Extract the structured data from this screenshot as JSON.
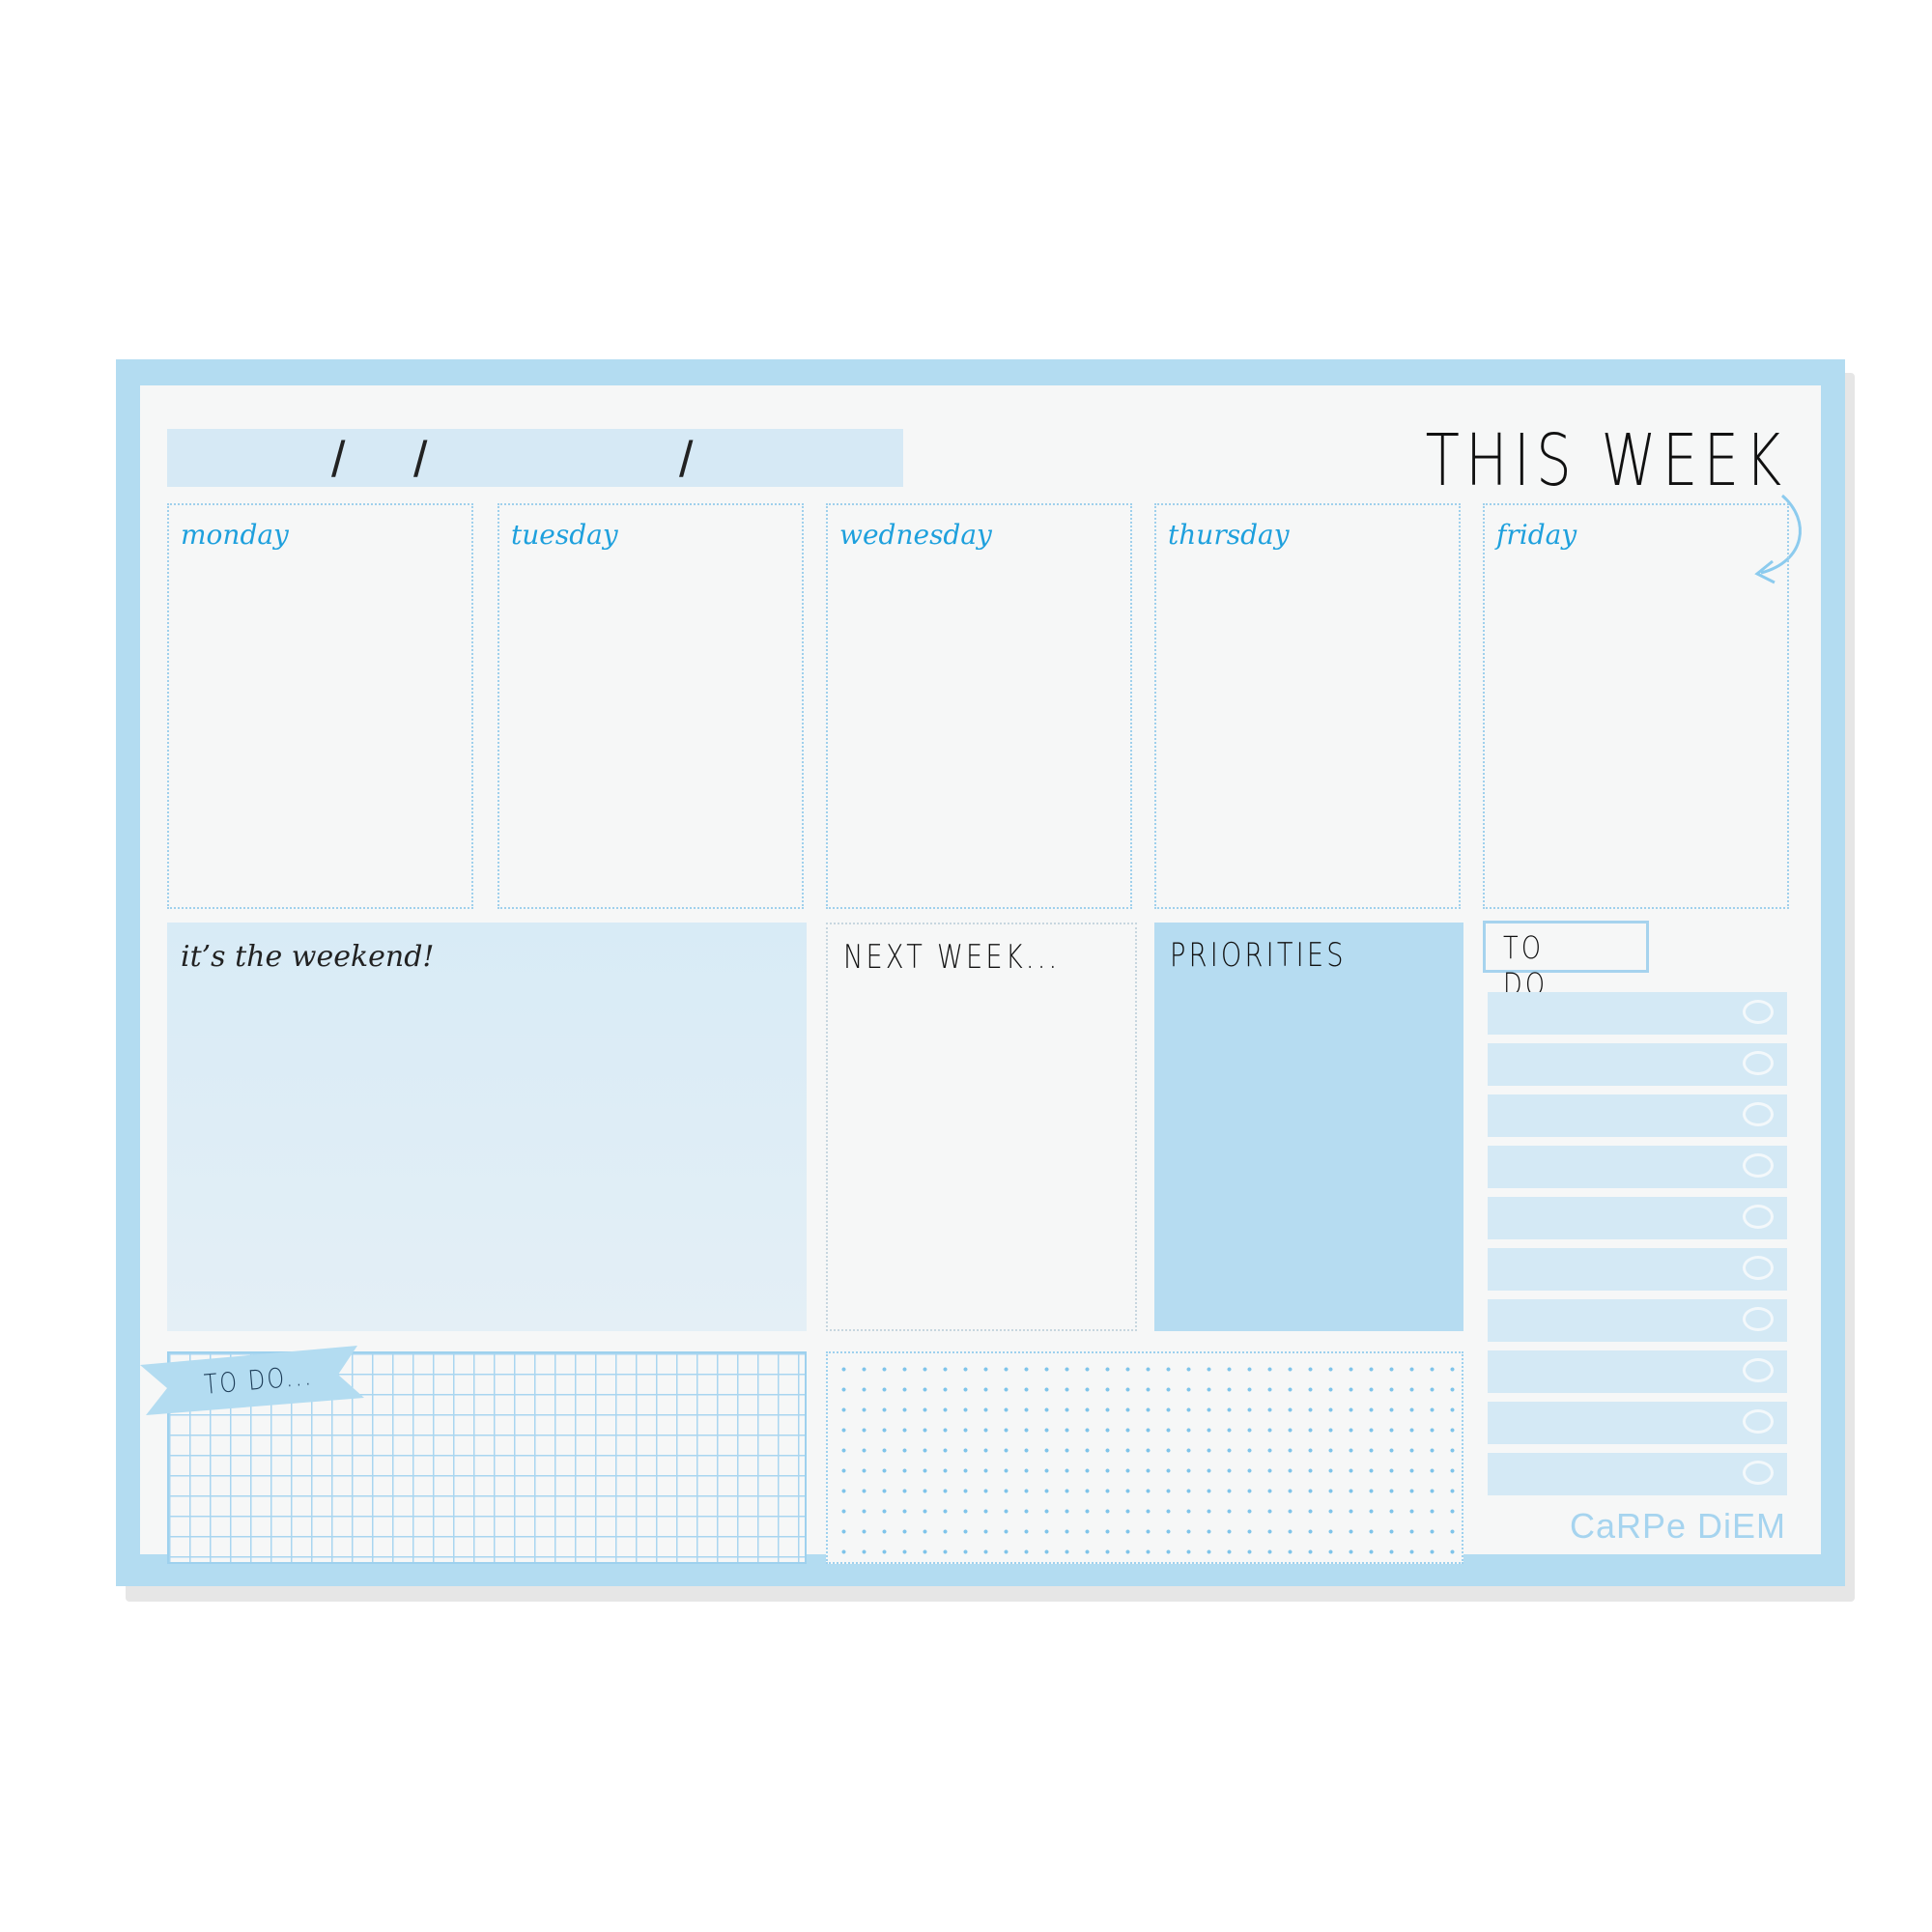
{
  "header": {
    "title": "THIS WEEK",
    "date_separators": [
      "/",
      "/",
      "/"
    ]
  },
  "days": [
    {
      "label": "monday"
    },
    {
      "label": "tuesday"
    },
    {
      "label": "wednesday"
    },
    {
      "label": "thursday"
    },
    {
      "label": "friday"
    }
  ],
  "sections": {
    "weekend": "it’s the weekend!",
    "next_week": "NEXT WEEK...",
    "priorities": "PRIORITIES",
    "todo_side": "TO DO...",
    "todo_grid": "TO DO..."
  },
  "todo_rows": 10,
  "brand": "CaRPe DiEM",
  "colors": {
    "pad_border": "#b3dcf1",
    "paper": "#f6f7f7",
    "accent": "#1ea0dd",
    "light_fill": "#d6e9f5",
    "priorities_fill": "#b6dcf1"
  }
}
